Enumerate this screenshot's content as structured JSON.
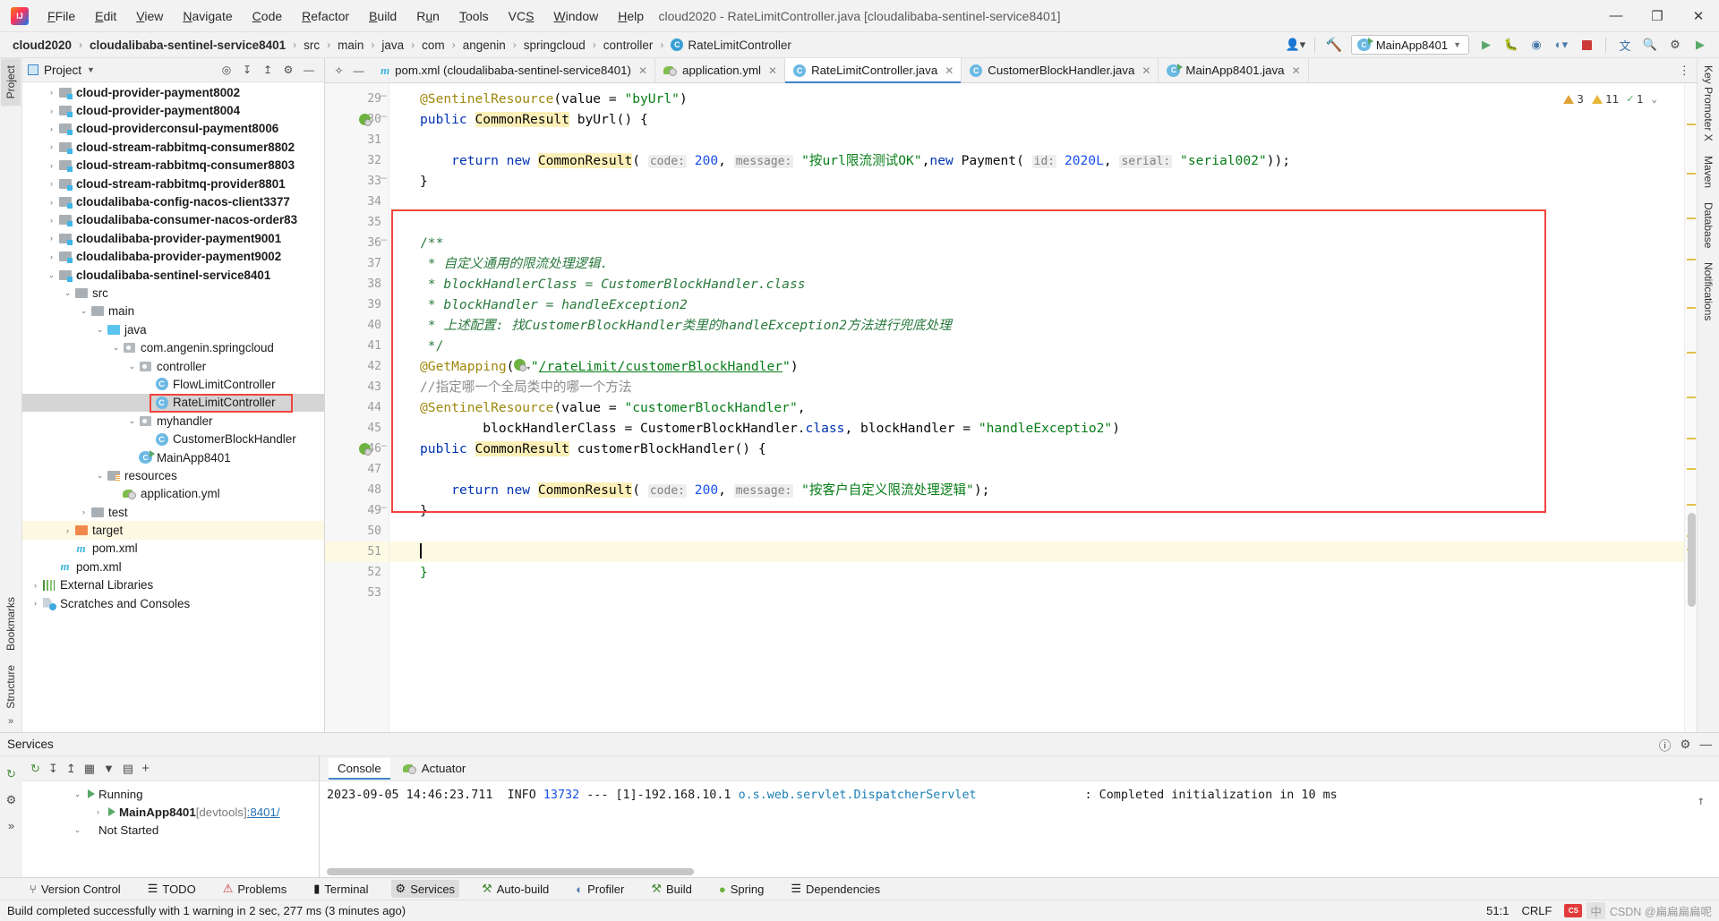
{
  "titlebar": {
    "logo": "intellij-logo",
    "menus": [
      "File",
      "Edit",
      "View",
      "Navigate",
      "Code",
      "Refactor",
      "Build",
      "Run",
      "Tools",
      "VCS",
      "Window",
      "Help"
    ],
    "window_title": "cloud2020 - RateLimitController.java [cloudalibaba-sentinel-service8401]",
    "minimize": "—",
    "maximize": "❐",
    "close": "✕"
  },
  "navbar": {
    "crumbs": [
      "cloud2020",
      "cloudalibaba-sentinel-service8401",
      "src",
      "main",
      "java",
      "com",
      "angenin",
      "springcloud",
      "controller",
      "RateLimitController"
    ],
    "separator": "›",
    "class_badge": "C",
    "run_config": "MainApp8401",
    "icons": [
      "account-icon",
      "build-hammer-icon",
      "run-icon",
      "debug-icon",
      "run-coverage-icon",
      "profiler-icon",
      "stop-icon",
      "translate-icon",
      "search-icon",
      "settings-icon",
      "updates-icon"
    ]
  },
  "left_rail": [
    "Project",
    "Structure",
    "Bookmarks"
  ],
  "right_rail": [
    "Key Promoter X",
    "Maven",
    "Database",
    "Notifications"
  ],
  "project_panel": {
    "title": "Project",
    "actions": [
      "locate-icon",
      "expand-all-icon",
      "collapse-all-icon",
      "settings-icon",
      "hide-icon"
    ],
    "tree": [
      {
        "indent": 1,
        "arrow": "›",
        "icon": "module",
        "label": "cloud-provider-payment8002",
        "bold": true,
        "state": "partial"
      },
      {
        "indent": 1,
        "arrow": "›",
        "icon": "module",
        "label": "cloud-provider-payment8004",
        "bold": true
      },
      {
        "indent": 1,
        "arrow": "›",
        "icon": "module",
        "label": "cloud-providerconsul-payment8006",
        "bold": true
      },
      {
        "indent": 1,
        "arrow": "›",
        "icon": "module",
        "label": "cloud-stream-rabbitmq-consumer8802",
        "bold": true
      },
      {
        "indent": 1,
        "arrow": "›",
        "icon": "module",
        "label": "cloud-stream-rabbitmq-consumer8803",
        "bold": true
      },
      {
        "indent": 1,
        "arrow": "›",
        "icon": "module",
        "label": "cloud-stream-rabbitmq-provider8801",
        "bold": true
      },
      {
        "indent": 1,
        "arrow": "›",
        "icon": "module",
        "label": "cloudalibaba-config-nacos-client3377",
        "bold": true
      },
      {
        "indent": 1,
        "arrow": "›",
        "icon": "module",
        "label": "cloudalibaba-consumer-nacos-order83",
        "bold": true
      },
      {
        "indent": 1,
        "arrow": "›",
        "icon": "module",
        "label": "cloudalibaba-provider-payment9001",
        "bold": true
      },
      {
        "indent": 1,
        "arrow": "›",
        "icon": "module",
        "label": "cloudalibaba-provider-payment9002",
        "bold": true
      },
      {
        "indent": 1,
        "arrow": "⌄",
        "icon": "module",
        "label": "cloudalibaba-sentinel-service8401",
        "bold": true
      },
      {
        "indent": 2,
        "arrow": "⌄",
        "icon": "folder",
        "label": "src"
      },
      {
        "indent": 3,
        "arrow": "⌄",
        "icon": "folder",
        "label": "main"
      },
      {
        "indent": 4,
        "arrow": "⌄",
        "icon": "folder-blue",
        "label": "java"
      },
      {
        "indent": 5,
        "arrow": "⌄",
        "icon": "package",
        "label": "com.angenin.springcloud"
      },
      {
        "indent": 6,
        "arrow": "⌄",
        "icon": "package",
        "label": "controller"
      },
      {
        "indent": 7,
        "arrow": "",
        "icon": "class",
        "label": "FlowLimitController"
      },
      {
        "indent": 7,
        "arrow": "",
        "icon": "class",
        "label": "RateLimitController",
        "selected": true,
        "boxed": true
      },
      {
        "indent": 6,
        "arrow": "⌄",
        "icon": "package",
        "label": "myhandler"
      },
      {
        "indent": 7,
        "arrow": "",
        "icon": "class",
        "label": "CustomerBlockHandler"
      },
      {
        "indent": 6,
        "arrow": "",
        "icon": "runnable-class",
        "label": "MainApp8401"
      },
      {
        "indent": 4,
        "arrow": "⌄",
        "icon": "folder-resources",
        "label": "resources"
      },
      {
        "indent": 5,
        "arrow": "",
        "icon": "yaml",
        "label": "application.yml"
      },
      {
        "indent": 3,
        "arrow": "›",
        "icon": "folder",
        "label": "test"
      },
      {
        "indent": 2,
        "arrow": "›",
        "icon": "folder-orange",
        "label": "target",
        "highlighted": true
      },
      {
        "indent": 2,
        "arrow": "",
        "icon": "maven",
        "label": "pom.xml"
      },
      {
        "indent": 1,
        "arrow": "",
        "icon": "maven",
        "label": "pom.xml"
      },
      {
        "indent": 0,
        "arrow": "›",
        "icon": "libraries",
        "label": "External Libraries"
      },
      {
        "indent": 0,
        "arrow": "›",
        "icon": "scratches",
        "label": "Scratches and Consoles"
      }
    ]
  },
  "editor": {
    "tabs": [
      {
        "icon": "maven-icon",
        "label": "pom.xml (cloudalibaba-sentinel-service8401)",
        "active": false
      },
      {
        "icon": "yaml-icon",
        "label": "application.yml",
        "active": false
      },
      {
        "icon": "class-icon",
        "label": "RateLimitController.java",
        "active": true
      },
      {
        "icon": "class-icon",
        "label": "CustomerBlockHandler.java",
        "active": false
      },
      {
        "icon": "runnable-class-icon",
        "label": "MainApp8401.java",
        "active": false
      }
    ],
    "tab_close": "✕",
    "inspection": {
      "warnings_weak": "3",
      "warnings": "11",
      "typos": "1",
      "collapse": "⌄"
    },
    "first_line": 29,
    "lines": [
      {
        "n": 29,
        "gutter_icon": "",
        "fold": "top"
      },
      {
        "n": 30,
        "gutter_icon": "spring-bean",
        "fold": "mid"
      },
      {
        "n": 31
      },
      {
        "n": 32
      },
      {
        "n": 33,
        "fold": "end"
      },
      {
        "n": 34
      },
      {
        "n": 35
      },
      {
        "n": 36,
        "fold": "top"
      },
      {
        "n": 37
      },
      {
        "n": 38
      },
      {
        "n": 39
      },
      {
        "n": 40
      },
      {
        "n": 41
      },
      {
        "n": 42
      },
      {
        "n": 43
      },
      {
        "n": 44
      },
      {
        "n": 45
      },
      {
        "n": 46,
        "gutter_icon": "spring-bean",
        "fold": "mid"
      },
      {
        "n": 47
      },
      {
        "n": 48
      },
      {
        "n": 49,
        "fold": "end"
      },
      {
        "n": 50
      },
      {
        "n": 51,
        "current": true
      },
      {
        "n": 52
      },
      {
        "n": 53
      }
    ],
    "code_text": {
      "l29": "@SentinelResource(value = \"byUrl\")",
      "l30": "public CommonResult byUrl() {",
      "l32": "return new CommonResult( code: 200, message: \"按url限流测试OK\",new Payment( id: 2020L, serial: \"serial002\"));",
      "l33": "}",
      "l36": "/**",
      "l37": "* 自定义通用的限流处理逻辑.",
      "l38": "* blockHandlerClass = CustomerBlockHandler.class",
      "l39": "* blockHandler = handleException2",
      "l40": "* 上述配置: 找CustomerBlockHandler类里的handleException2方法进行兜底处理",
      "l41": "*/",
      "l42": "@GetMapping(\"/rateLimit/customerBlockHandler\")",
      "l43": "//指定哪一个全局类中的哪一个方法",
      "l44": "@SentinelResource(value = \"customerBlockHandler\",",
      "l45": "blockHandlerClass = CustomerBlockHandler.class, blockHandler = \"handleExceptio2\")",
      "l46": "public CommonResult customerBlockHandler() {",
      "l48": "return new CommonResult( code: 200, message: \"按客户自定义限流处理逻辑\");",
      "l49": "}",
      "l52": "}"
    }
  },
  "services": {
    "title": "Services",
    "head_icons": [
      "help-icon",
      "settings-icon",
      "hide-icon"
    ],
    "toolbar_icons": [
      "refresh-icon",
      "expand-icon",
      "collapse-icon",
      "group-icon",
      "filter-icon",
      "view-icon",
      "add-icon"
    ],
    "tree": [
      {
        "indent": 1,
        "arrow": "⌄",
        "icon": "run-green",
        "label": "Running"
      },
      {
        "indent": 2,
        "arrow": "›",
        "icon": "run-green",
        "label": "MainApp8401",
        "suffix": " [devtools] ",
        "link": ":8401/",
        "bold": true
      },
      {
        "indent": 1,
        "arrow": "⌄",
        "icon": "",
        "label": "Not Started"
      }
    ],
    "tabs": [
      {
        "label": "Console",
        "active": true,
        "icon": ""
      },
      {
        "label": "Actuator",
        "active": false,
        "icon": "actuator-icon"
      }
    ],
    "console_line": {
      "timestamp": "2023-09-05 14:46:23.711",
      "level": "INFO",
      "pid": "13732",
      "sep": "---",
      "thread": "[1]-192.168.10.1",
      "logger": "o.s.web.servlet.DispatcherServlet",
      "colon": ":",
      "message": "Completed initialization in 10 ms"
    }
  },
  "toolstrip": [
    {
      "icon": "branch-icon",
      "label": "Version Control"
    },
    {
      "icon": "todo-icon",
      "label": "TODO"
    },
    {
      "icon": "problems-icon",
      "label": "Problems"
    },
    {
      "icon": "terminal-icon",
      "label": "Terminal"
    },
    {
      "icon": "services-icon",
      "label": "Services",
      "active": true
    },
    {
      "icon": "build-icon",
      "label": "Auto-build"
    },
    {
      "icon": "profiler-icon",
      "label": "Profiler"
    },
    {
      "icon": "build-icon",
      "label": "Build"
    },
    {
      "icon": "spring-icon",
      "label": "Spring"
    },
    {
      "icon": "dependencies-icon",
      "label": "Dependencies"
    }
  ],
  "statusbar": {
    "message": "Build completed successfully with 1 warning in 2 sec, 277 ms (3 minutes ago)",
    "caret": "51:1",
    "line_sep": "CRLF",
    "ime": "中",
    "watermark": "CSDN @扁扁扁扁呢"
  },
  "colors": {
    "accent": "#4083c9",
    "keyword": "#0033b3",
    "string": "#067d17",
    "number": "#1750eb",
    "annotation": "#9e880d",
    "doc_comment": "#2a7a3e",
    "line_comment": "#8c8c8c",
    "highlight_box": "#f1453d",
    "selection": "#d4d4d4"
  }
}
